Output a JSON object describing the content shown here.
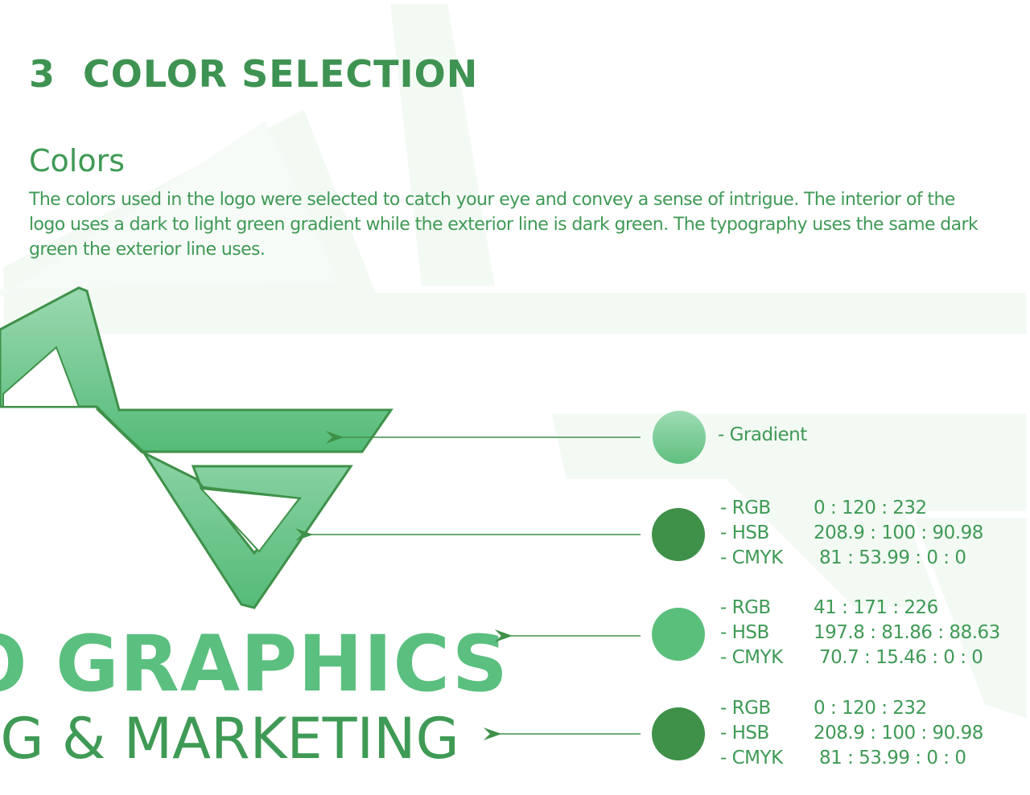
{
  "section": {
    "number": "3",
    "title": "COLOR SELECTION"
  },
  "colors": {
    "heading": "Colors",
    "description": "The colors used in the logo were selected to catch your eye and convey a sense of intrigue. The interior of the logo uses a dark to light green gradient while the exterior line is dark green. The typography uses the same dark green the exterior line uses."
  },
  "logo": {
    "wordmark_main": "O GRAPHICS",
    "wordmark_sub": "NG & MARKETING"
  },
  "swatches": [
    {
      "label": "- Gradient",
      "color_top": "#9fdcb4",
      "color_bottom": "#5fbf7f"
    },
    {
      "color": "#3f9149",
      "specs": [
        {
          "name": "- RGB",
          "value": "0 : 120 : 232"
        },
        {
          "name": "- HSB",
          "value": "208.9 : 100 : 90.98"
        },
        {
          "name": "- CMYK",
          "value": "81 : 53.99 : 0 : 0"
        }
      ]
    },
    {
      "color": "#5bbf7c",
      "specs": [
        {
          "name": "- RGB",
          "value": "41 : 171 : 226"
        },
        {
          "name": "- HSB",
          "value": "197.8 : 81.86 : 88.63"
        },
        {
          "name": "- CMYK",
          "value": "70.7 : 15.46 : 0 : 0"
        }
      ]
    },
    {
      "color": "#3f9149",
      "specs": [
        {
          "name": "- RGB",
          "value": "0 : 120 : 232"
        },
        {
          "name": "- HSB",
          "value": "208.9 : 100 : 90.98"
        },
        {
          "name": "- CMYK",
          "value": "81 : 53.99 : 0 : 0"
        }
      ]
    }
  ],
  "palette": {
    "dark_green": "#3f9149",
    "text_green": "#3f9a55",
    "light_green": "#5bbf7c",
    "watermark": "#f1f8f2"
  }
}
